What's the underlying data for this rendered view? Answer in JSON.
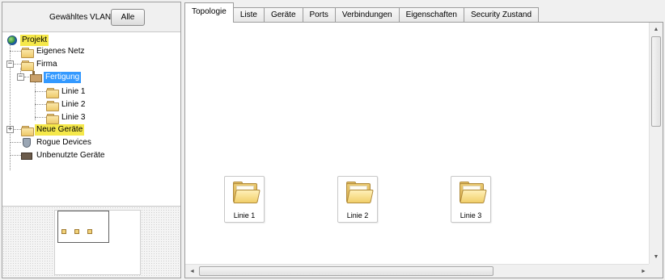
{
  "vlan": {
    "label": "Gewähltes VLAN:",
    "button": "Alle"
  },
  "tree": {
    "projekt": "Projekt",
    "eigenes_netz": "Eigenes Netz",
    "firma": "Firma",
    "fertigung": "Fertigung",
    "linie1": "Linie 1",
    "linie2": "Linie 2",
    "linie3": "Linie 3",
    "neue_geraete": "Neue Geräte",
    "rogue_devices": "Rogue Devices",
    "unbenutzte_geraete": "Unbenutzte Geräte",
    "collapse_glyph": "−",
    "expand_glyph": "+"
  },
  "tabs": [
    "Topologie",
    "Liste",
    "Geräte",
    "Ports",
    "Verbindungen",
    "Eigenschaften",
    "Security Zustand"
  ],
  "active_tab": "Topologie",
  "nodes": [
    "Linie 1",
    "Linie 2",
    "Linie 3"
  ],
  "scroll": {
    "up": "▲",
    "down": "▼",
    "left": "◄",
    "right": "►",
    "grip": "⦀"
  },
  "colors": {
    "highlight_yellow": "#f5e84a",
    "selection_blue": "#3399ff"
  }
}
